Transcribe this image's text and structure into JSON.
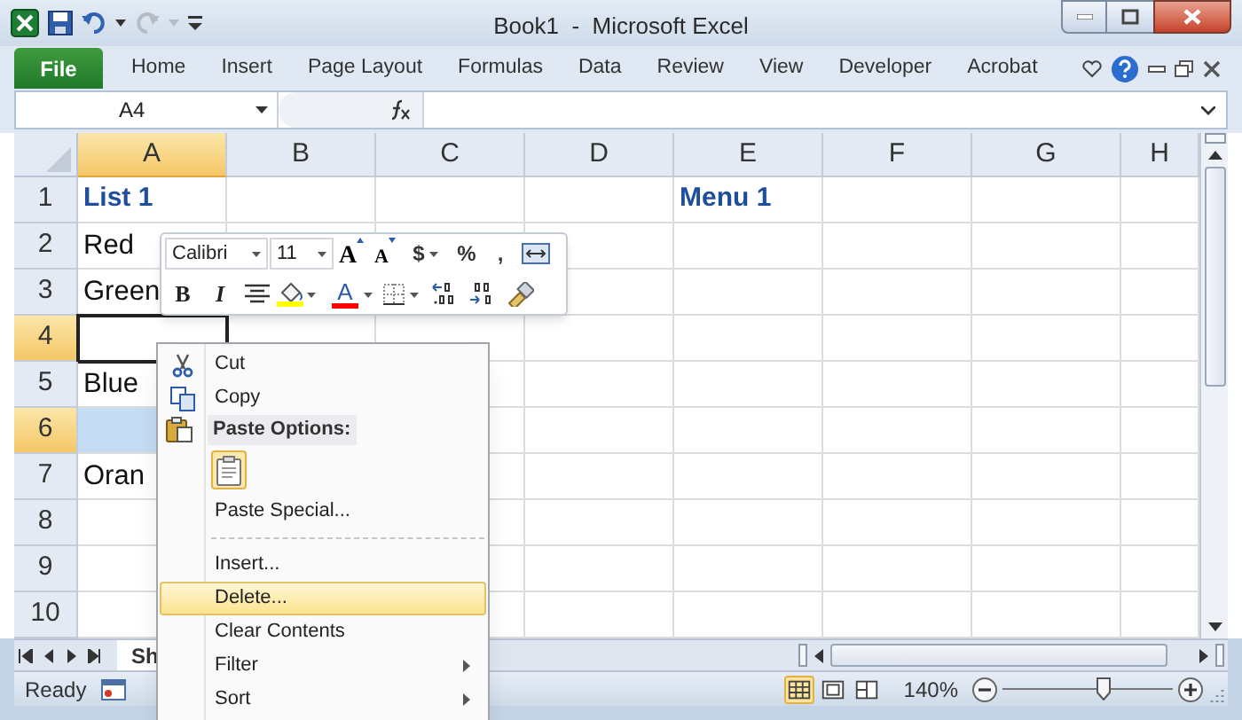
{
  "window": {
    "title": "Book1  -  Microsoft Excel"
  },
  "ribbon": {
    "tabs": [
      {
        "label": "File",
        "kind": "file",
        "selected": false
      },
      {
        "label": "Home",
        "kind": "tab",
        "selected": false
      },
      {
        "label": "Insert",
        "kind": "tab",
        "selected": false
      },
      {
        "label": "Page Layout",
        "kind": "tab",
        "selected": false
      },
      {
        "label": "Formulas",
        "kind": "tab",
        "selected": false
      },
      {
        "label": "Data",
        "kind": "tab",
        "selected": false
      },
      {
        "label": "Review",
        "kind": "tab",
        "selected": false
      },
      {
        "label": "View",
        "kind": "tab",
        "selected": false
      },
      {
        "label": "Developer",
        "kind": "tab",
        "selected": false
      },
      {
        "label": "Acrobat",
        "kind": "tab",
        "selected": false
      }
    ]
  },
  "formula_bar": {
    "name_box": "A4"
  },
  "columns": [
    {
      "label": "A",
      "selected": true
    },
    {
      "label": "B",
      "selected": false
    },
    {
      "label": "C",
      "selected": false
    },
    {
      "label": "D",
      "selected": false
    },
    {
      "label": "E",
      "selected": false
    },
    {
      "label": "F",
      "selected": false
    },
    {
      "label": "G",
      "selected": false
    },
    {
      "label": "H",
      "selected": false
    }
  ],
  "rows": [
    {
      "number": "1",
      "selected": false,
      "a_active": false,
      "a_highlighted": false,
      "kind": "heading",
      "column_a": "List 1",
      "column_e": "Menu 1"
    },
    {
      "number": "2",
      "selected": false,
      "a_active": false,
      "a_highlighted": false,
      "kind": "plain",
      "column_a": "Red"
    },
    {
      "number": "3",
      "selected": false,
      "a_active": false,
      "a_highlighted": false,
      "kind": "plain",
      "column_a": "Green"
    },
    {
      "number": "4",
      "selected": true,
      "a_active": true,
      "a_highlighted": false
    },
    {
      "number": "5",
      "selected": false,
      "a_active": false,
      "a_highlighted": false,
      "kind": "plain",
      "column_a": "Blue"
    },
    {
      "number": "6",
      "selected": true,
      "a_active": false,
      "a_highlighted": true
    },
    {
      "number": "7",
      "selected": false,
      "a_active": false,
      "a_highlighted": false,
      "kind": "plain",
      "column_a": "Oran"
    },
    {
      "number": "8",
      "selected": false,
      "a_active": false,
      "a_highlighted": false
    },
    {
      "number": "9",
      "selected": false,
      "a_active": false,
      "a_highlighted": false
    },
    {
      "number": "10",
      "selected": false,
      "a_active": false,
      "a_highlighted": false
    }
  ],
  "mini_toolbar": {
    "top_row": [
      {
        "kind": "dropdown",
        "value": "Calibri"
      },
      {
        "kind": "dropdown",
        "value": "11"
      },
      {
        "kind": "grow",
        "label": "A"
      },
      {
        "kind": "shrink",
        "label": "A"
      },
      {
        "kind": "currency",
        "label": "$"
      },
      {
        "kind": "symbol",
        "label": "%"
      },
      {
        "kind": "symbol",
        "label": ","
      },
      {
        "kind": "merge"
      }
    ],
    "bottom_row": [
      {
        "kind": "bold",
        "label": "B"
      },
      {
        "kind": "italic",
        "label": "I"
      },
      {
        "kind": "center"
      },
      {
        "kind": "fill",
        "color": "#ffff00"
      },
      {
        "kind": "font_color",
        "label": "A",
        "color": "#ff0000"
      },
      {
        "kind": "borders"
      },
      {
        "kind": "inc_decimal"
      },
      {
        "kind": "dec_decimal"
      },
      {
        "kind": "painter"
      }
    ]
  },
  "context_menu": [
    {
      "kind": "item",
      "label": "Cut",
      "selected": false
    },
    {
      "kind": "item",
      "label": "Copy",
      "selected": false
    },
    {
      "kind": "header",
      "label": "Paste Options:"
    },
    {
      "kind": "paste_icons"
    },
    {
      "kind": "item",
      "label": "Paste Special...",
      "selected": false
    },
    {
      "kind": "separator"
    },
    {
      "kind": "item",
      "label": "Insert...",
      "selected": false
    },
    {
      "kind": "item",
      "label": "Delete...",
      "selected": true
    },
    {
      "kind": "item",
      "label": "Clear Contents",
      "selected": false
    },
    {
      "kind": "submenu",
      "label": "Filter",
      "selected": false
    },
    {
      "kind": "submenu",
      "label": "Sort",
      "selected": false
    }
  ],
  "sheet_tabs": [
    {
      "label": "Sh",
      "selected": true
    }
  ],
  "status_bar": {
    "status": "Ready",
    "views": [
      {
        "selected": true
      },
      {
        "selected": false
      },
      {
        "selected": false
      }
    ],
    "zoom": "140%",
    "zoom_slider": {
      "level": 0.6
    }
  }
}
